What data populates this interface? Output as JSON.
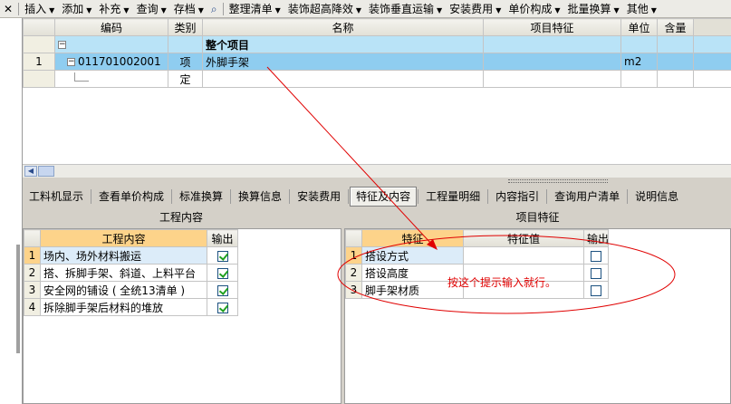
{
  "toolbar": {
    "items": [
      "插入",
      "添加",
      "补充",
      "查询",
      "存档",
      "整理清单",
      "装饰超高降效",
      "装饰垂直运输",
      "安装费用",
      "单价构成",
      "批量换算",
      "其他"
    ]
  },
  "upper": {
    "headers": [
      "编码",
      "类别",
      "名称",
      "项目特征",
      "单位",
      "含量"
    ],
    "group_label": "整个项目",
    "rows": [
      {
        "num": "1",
        "code": "011701002001",
        "cat": "项",
        "name": "外脚手架",
        "feature": "",
        "unit": "m2",
        "qty": ""
      },
      {
        "num": "",
        "code": "",
        "cat": "定",
        "name": "",
        "feature": "",
        "unit": "",
        "qty": ""
      }
    ],
    "expand_sign": "−"
  },
  "tabs": [
    "工料机显示",
    "查看单价构成",
    "标准换算",
    "换算信息",
    "安装费用",
    "特征及内容",
    "工程量明细",
    "内容指引",
    "查询用户清单",
    "说明信息"
  ],
  "active_tab": "特征及内容",
  "section_left": "工程内容",
  "section_right": "项目特征",
  "work": {
    "headers": [
      "工程内容",
      "输出"
    ],
    "rows": [
      {
        "num": "1",
        "text": "场内、场外材料搬运",
        "checked": true
      },
      {
        "num": "2",
        "text": "搭、拆脚手架、斜道、上料平台",
        "checked": true
      },
      {
        "num": "3",
        "text": "安全网的铺设 ( 全统13清单 )",
        "checked": true
      },
      {
        "num": "4",
        "text": "拆除脚手架后材料的堆放",
        "checked": true
      }
    ]
  },
  "features": {
    "headers": [
      "特征",
      "特征值",
      "输出"
    ],
    "rows": [
      {
        "num": "1",
        "name": "搭设方式",
        "value": "",
        "checked": false
      },
      {
        "num": "2",
        "name": "搭设高度",
        "value": "",
        "checked": false
      },
      {
        "num": "3",
        "name": "脚手架材质",
        "value": "",
        "checked": false
      }
    ]
  },
  "annotation": "按这个提示输入就行。",
  "colors": {
    "annotation": "#e00000",
    "selected_row": "#8fcdf0"
  }
}
